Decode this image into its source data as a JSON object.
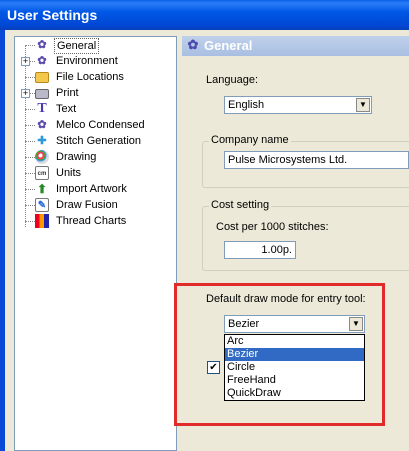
{
  "window": {
    "title": "User Settings"
  },
  "tree": {
    "items": [
      {
        "label": "General",
        "icon": "gear-icon",
        "selected": true,
        "expander": ""
      },
      {
        "label": "Environment",
        "icon": "gear-icon",
        "selected": false,
        "expander": "+"
      },
      {
        "label": "File Locations",
        "icon": "folder-icon",
        "selected": false,
        "expander": ""
      },
      {
        "label": "Print",
        "icon": "printer-icon",
        "selected": false,
        "expander": "+"
      },
      {
        "label": "Text",
        "icon": "text-icon",
        "selected": false,
        "expander": ""
      },
      {
        "label": "Melco Condensed",
        "icon": "gear-icon",
        "selected": false,
        "expander": ""
      },
      {
        "label": "Stitch Generation",
        "icon": "stitch-icon",
        "selected": false,
        "expander": ""
      },
      {
        "label": "Drawing",
        "icon": "palette-icon",
        "selected": false,
        "expander": ""
      },
      {
        "label": "Units",
        "icon": "units-icon",
        "selected": false,
        "expander": ""
      },
      {
        "label": "Import Artwork",
        "icon": "import-icon",
        "selected": false,
        "expander": ""
      },
      {
        "label": "Draw Fusion",
        "icon": "draw-fusion-icon",
        "selected": false,
        "expander": ""
      },
      {
        "label": "Thread Charts",
        "icon": "thread-chart-icon",
        "selected": false,
        "expander": ""
      }
    ]
  },
  "panel": {
    "title": "General",
    "language": {
      "label": "Language:",
      "value": "English"
    },
    "company": {
      "group_title": "Company name",
      "value": "Pulse Microsystems Ltd."
    },
    "cost": {
      "group_title": "Cost setting",
      "label": "Cost per 1000 stitches:",
      "value": "1.00p."
    },
    "draw_mode": {
      "label": "Default draw mode for entry tool:",
      "value": "Bezier",
      "options": [
        "Arc",
        "Bezier",
        "Circle",
        "FreeHand",
        "QuickDraw"
      ],
      "selected_index": 1
    },
    "checkbox": {
      "mark": "✔"
    }
  },
  "colors": {
    "highlight": "#e12a2a",
    "selection": "#316ac5",
    "title_bar": "#0058e6"
  }
}
